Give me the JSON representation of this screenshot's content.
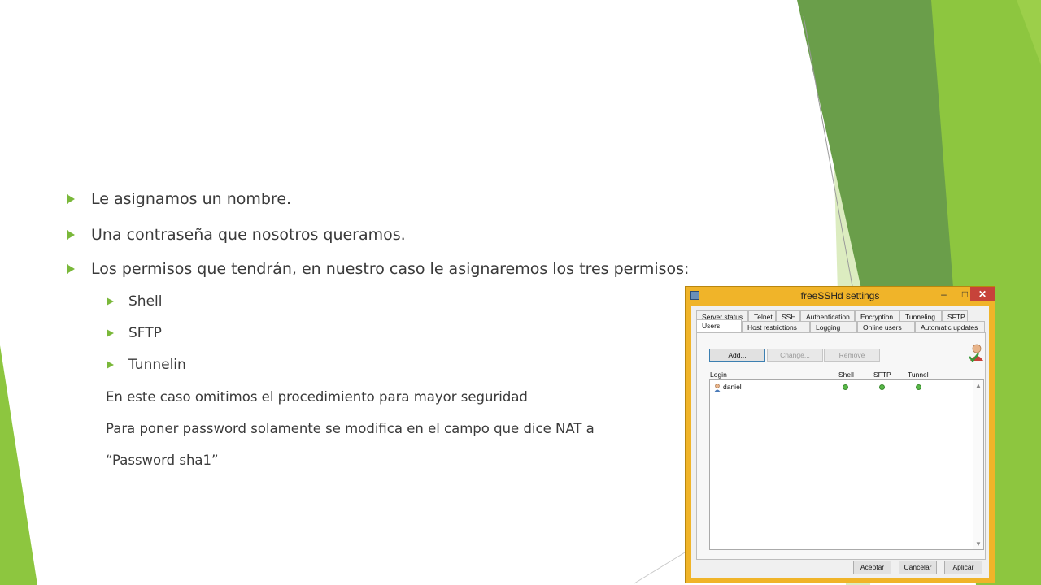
{
  "slide": {
    "bullets": [
      "Le asignamos un nombre.",
      "Una contraseña que nosotros queramos.",
      "Los permisos que tendrán, en nuestro caso le asignaremos los tres permisos:"
    ],
    "sub_bullets": [
      "Shell",
      "SFTP",
      "Tunnelin"
    ],
    "paragraphs": [
      "En este caso omitimos el procedimiento para mayor seguridad",
      "Para poner password solamente se modifica en el campo que dice NAT a",
      "“Password  sha1”"
    ],
    "colors": {
      "accent": "#7ab83a",
      "green_dark": "#5f9b3c",
      "green_light": "#8dc63f"
    }
  },
  "window": {
    "title": "freeSSHd settings",
    "controls": {
      "minimize": "–",
      "maximize": "□",
      "close": "✕"
    },
    "tabs_top": [
      "Server status",
      "Telnet",
      "SSH",
      "Authentication",
      "Encryption",
      "Tunneling",
      "SFTP"
    ],
    "tabs_bottom": [
      "Users",
      "Host restrictions",
      "Logging",
      "Online users",
      "Automatic updates"
    ],
    "active_tab": "Users",
    "buttons": {
      "add": "Add...",
      "change": "Change...",
      "remove": "Remove"
    },
    "columns": {
      "login": "Login",
      "shell": "Shell",
      "sftp": "SFTP",
      "tunnel": "Tunnel"
    },
    "users": [
      {
        "login": "daniel",
        "shell": true,
        "sftp": true,
        "tunnel": true
      }
    ],
    "footer": {
      "ok": "Aceptar",
      "cancel": "Cancelar",
      "apply": "Aplicar"
    },
    "colors": {
      "frame": "#f0b429",
      "close": "#c7433a",
      "status_dot": "#58b848"
    }
  }
}
